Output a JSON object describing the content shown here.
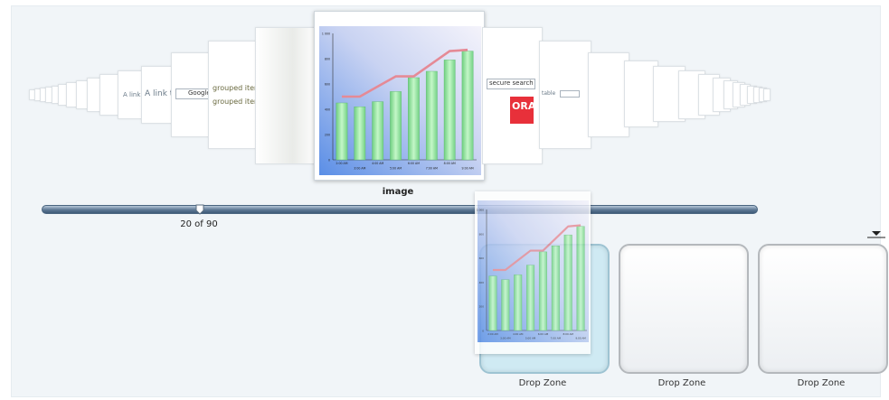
{
  "carousel": {
    "current_caption": "image",
    "current_index": 20,
    "total": 90,
    "counter_text": "20 of 90",
    "progress_fraction": 0.222,
    "left_cards_text": {
      "link_small": "A link to",
      "link_large": "A link to",
      "google_button": "Google",
      "grouped_1": "grouped item",
      "grouped_2": "grouped item"
    },
    "right_cards_text": {
      "secure_search": "secure search",
      "ora_logo": "ORA",
      "table_label": "table"
    }
  },
  "chart_data": {
    "type": "bar",
    "categories": [
      "",
      "",
      "",
      "",
      "",
      "",
      "",
      ""
    ],
    "x_tick_labels_top": [
      "2:00 AM",
      "4:00 AM",
      "6:00 AM",
      "8:00 AM"
    ],
    "x_tick_labels_bottom": [
      "3:00 AM",
      "5:00 AM",
      "7:00 AM",
      "9:00 AM"
    ],
    "y_tick_labels": [
      "0",
      "200",
      "400",
      "600",
      "800",
      "1 000"
    ],
    "ylim": [
      0,
      1000
    ],
    "series": [
      {
        "values": [
          450,
          420,
          460,
          540,
          650,
          700,
          790,
          860
        ]
      },
      {
        "values": [
          500,
          500,
          580,
          660,
          660,
          760,
          860,
          870
        ]
      }
    ],
    "colors": {
      "bars": "#8fe09a",
      "line": "#e58a96",
      "background": "#b9c9ee"
    }
  },
  "drop_zones": [
    {
      "label": "Drop Zone",
      "active": true
    },
    {
      "label": "Drop Zone",
      "active": false
    },
    {
      "label": "Drop Zone",
      "active": false
    }
  ],
  "icons": {
    "slider_thumb": "slider-thumb-icon",
    "overflow_menu": "dropdown-arrow-icon"
  }
}
